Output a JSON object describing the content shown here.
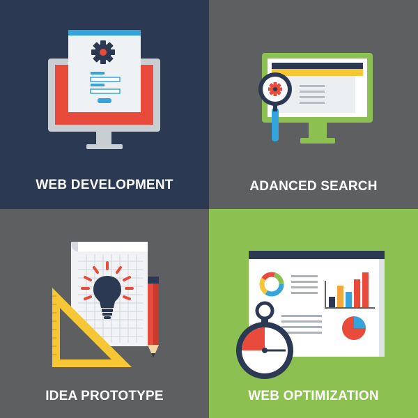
{
  "colors": {
    "navy": "#2b3a52",
    "gray": "#5d5f61",
    "green": "#8cc151",
    "red": "#e84b3c",
    "blue": "#35a3dc",
    "orange": "#f3a73c",
    "yellow": "#f7c634",
    "white": "#ffffff"
  },
  "tiles": [
    {
      "caption": "WEB DEVELOPMENT",
      "background": "#2b3a52",
      "icon": "monitor-gear-icon"
    },
    {
      "caption": "ADANCED SEARCH",
      "background": "#5d5f61",
      "icon": "monitor-magnifier-icon"
    },
    {
      "caption": "IDEA PROTOTYPE",
      "background": "#5d5f61",
      "icon": "lightbulb-blueprint-icon"
    },
    {
      "caption": "WEB OPTIMIZATION",
      "background": "#8cc151",
      "icon": "stopwatch-dashboard-icon"
    }
  ]
}
